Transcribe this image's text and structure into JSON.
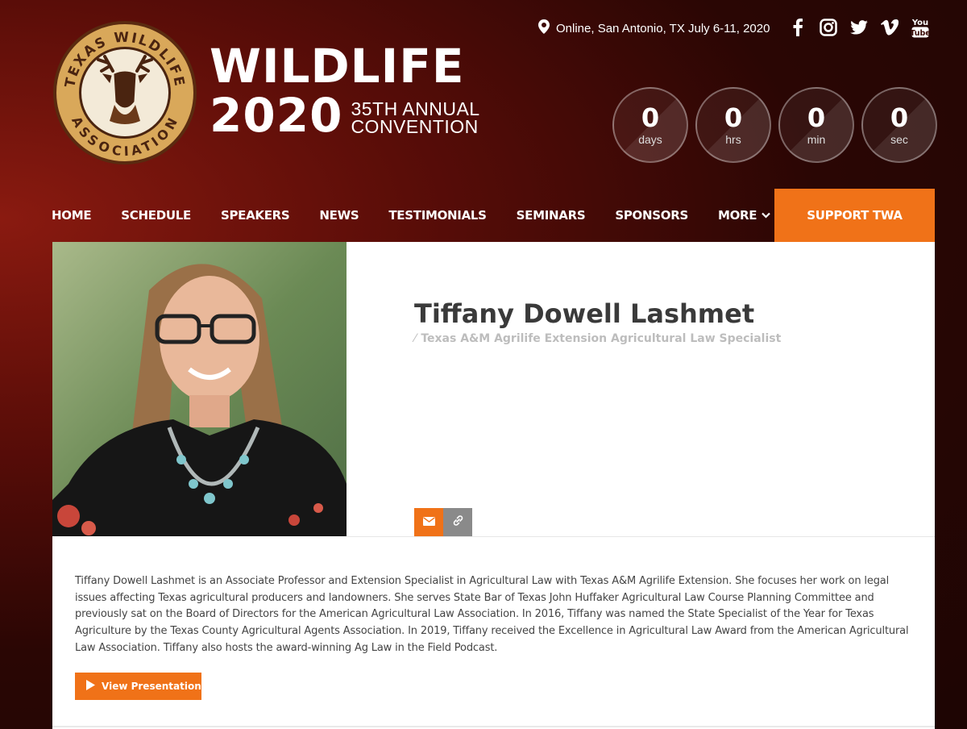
{
  "header": {
    "logo": {
      "ring_text_top": "TEXAS WILDLIFE",
      "ring_text_bottom": "ASSOCIATION",
      "colors": {
        "ring": "#d9a85a",
        "center": "#f3ead8",
        "deer": "#4a2410"
      }
    },
    "wordmark": {
      "line1": "WILDLIFE",
      "year": "2020",
      "sub1": "35TH ANNUAL",
      "sub2": "CONVENTION"
    },
    "location": {
      "icon": "map-pin-icon",
      "text": "Online, San Antonio, TX July 6-11, 2020"
    },
    "socials": [
      {
        "icon": "facebook-icon"
      },
      {
        "icon": "instagram-icon"
      },
      {
        "icon": "twitter-icon"
      },
      {
        "icon": "vimeo-icon"
      },
      {
        "icon": "youtube-icon",
        "text": "You\nTube"
      }
    ],
    "countdown": [
      {
        "value": "0",
        "unit": "days"
      },
      {
        "value": "0",
        "unit": "hrs"
      },
      {
        "value": "0",
        "unit": "min"
      },
      {
        "value": "0",
        "unit": "sec"
      }
    ]
  },
  "nav": {
    "items": [
      "HOME",
      "SCHEDULE",
      "SPEAKERS",
      "NEWS",
      "TESTIMONIALS",
      "SEMINARS",
      "SPONSORS",
      "MORE"
    ],
    "cta": "SUPPORT TWA"
  },
  "speaker": {
    "name": "Tiffany Dowell Lashmet",
    "title": "Texas A&M Agrilife Extension Agricultural Law Specialist",
    "bio": "Tiffany Dowell Lashmet is an Associate Professor and Extension Specialist in Agricultural Law with Texas A&M Agrilife Extension. She focuses her work on legal issues affecting Texas agricultural producers and landowners. She serves State Bar of Texas John Huffaker Agricultural Law Course Planning Committee and previously sat on the Board of Directors for the American Agricultural Law Association. In 2016, Tiffany was named the State Specialist of the Year for Texas Agriculture by the Texas County Agricultural Agents Association. In 2019, Tiffany received the Excellence in Agricultural Law Award from the American Agricultural Law Association.  Tiffany also hosts the award-winning Ag Law in the Field Podcast.",
    "view_button": "View Presentation"
  },
  "colors": {
    "accent": "#f07218",
    "link_button": "#8a8a8a"
  }
}
